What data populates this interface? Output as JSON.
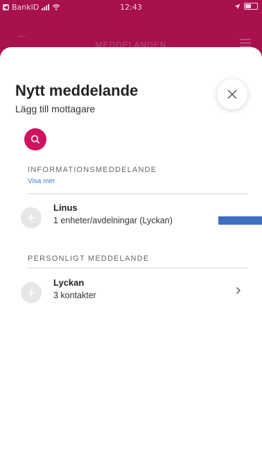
{
  "status_bar": {
    "back_app": "BankID",
    "time": "12:43"
  },
  "nav": {
    "title": "MEDDELANDEN"
  },
  "sheet": {
    "title": "Nytt meddelande",
    "subtitle": "Lägg till mottagare"
  },
  "sections": {
    "info": {
      "header": "INFORMATIONSMEDDELANDE",
      "show_more": "Visa mer",
      "items": [
        {
          "name": "Linus",
          "detail": "1 enheter/avdelningar (Lyckan)"
        }
      ]
    },
    "personal": {
      "header": "PERSONLIGT MEDDELANDE",
      "items": [
        {
          "name": "Lyckan",
          "detail": "3 kontakter"
        }
      ]
    }
  },
  "colors": {
    "brand": "#a8104e",
    "accent": "#d0135f",
    "link": "#3a7bd5",
    "highlight_bar": "#3d6ebf"
  },
  "icons": {
    "close": "close-icon",
    "search": "search-icon",
    "add": "plus-icon",
    "chevron": "chevron-right-icon"
  }
}
